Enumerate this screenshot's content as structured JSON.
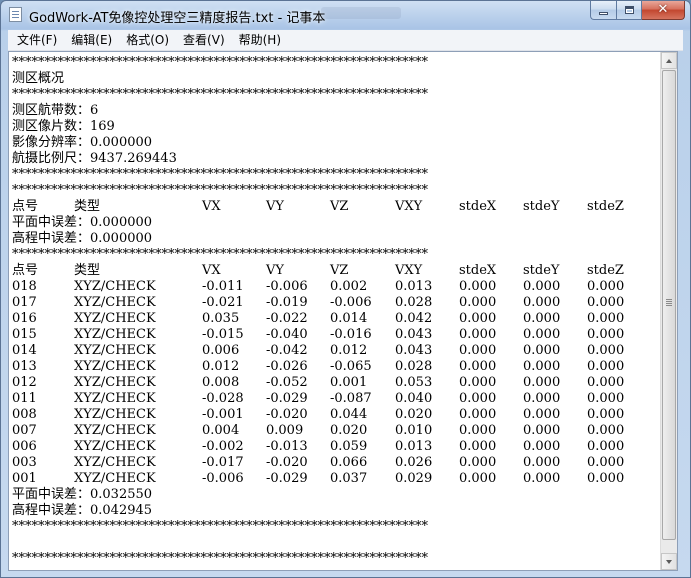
{
  "window": {
    "title": "GodWork-AT免像控处理空三精度报告.txt - 记事本"
  },
  "menu": [
    {
      "label": "文件(F)"
    },
    {
      "label": "编辑(E)"
    },
    {
      "label": "格式(O)"
    },
    {
      "label": "查看(V)"
    },
    {
      "label": "帮助(H)"
    }
  ],
  "caption": {
    "minimize_icon": "minimize-icon",
    "maximize_icon": "maximize-icon",
    "close_glyph": "✕"
  },
  "document": {
    "stars": "****************************************************************",
    "section_title": "测区概况",
    "summary": [
      "测区航带数：6",
      "测区像片数：169",
      "影像分辨率：0.000000",
      "航摄比例尺：9437.269443"
    ],
    "columns": [
      "点号",
      "类型",
      "VX",
      "VY",
      "VZ",
      "VXY",
      "stdeX",
      "stdeY",
      "stdeZ"
    ],
    "control_plane_error": "平面中误差：0.000000",
    "control_height_error": "高程中误差：0.000000",
    "check_rows": [
      [
        "018",
        "XYZ/CHECK",
        "-0.011",
        "-0.006",
        "0.002",
        "0.013",
        "0.000",
        "0.000",
        "0.000"
      ],
      [
        "017",
        "XYZ/CHECK",
        "-0.021",
        "-0.019",
        "-0.006",
        "0.028",
        "0.000",
        "0.000",
        "0.000"
      ],
      [
        "016",
        "XYZ/CHECK",
        "0.035",
        "-0.022",
        "0.014",
        "0.042",
        "0.000",
        "0.000",
        "0.000"
      ],
      [
        "015",
        "XYZ/CHECK",
        "-0.015",
        "-0.040",
        "-0.016",
        "0.043",
        "0.000",
        "0.000",
        "0.000"
      ],
      [
        "014",
        "XYZ/CHECK",
        "0.006",
        "-0.042",
        "0.012",
        "0.043",
        "0.000",
        "0.000",
        "0.000"
      ],
      [
        "013",
        "XYZ/CHECK",
        "0.012",
        "-0.026",
        "-0.065",
        "0.028",
        "0.000",
        "0.000",
        "0.000"
      ],
      [
        "012",
        "XYZ/CHECK",
        "0.008",
        "-0.052",
        "0.001",
        "0.053",
        "0.000",
        "0.000",
        "0.000"
      ],
      [
        "011",
        "XYZ/CHECK",
        "-0.028",
        "-0.029",
        "-0.087",
        "0.040",
        "0.000",
        "0.000",
        "0.000"
      ],
      [
        "008",
        "XYZ/CHECK",
        "-0.001",
        "-0.020",
        "0.044",
        "0.020",
        "0.000",
        "0.000",
        "0.000"
      ],
      [
        "007",
        "XYZ/CHECK",
        "0.004",
        "0.009",
        "0.020",
        "0.010",
        "0.000",
        "0.000",
        "0.000"
      ],
      [
        "006",
        "XYZ/CHECK",
        "-0.002",
        "-0.013",
        "0.059",
        "0.013",
        "0.000",
        "0.000",
        "0.000"
      ],
      [
        "003",
        "XYZ/CHECK",
        "-0.017",
        "-0.020",
        "0.066",
        "0.026",
        "0.000",
        "0.000",
        "0.000"
      ],
      [
        "001",
        "XYZ/CHECK",
        "-0.006",
        "-0.029",
        "0.037",
        "0.029",
        "0.000",
        "0.000",
        "0.000"
      ]
    ],
    "check_plane_error": "平面中误差：0.032550",
    "check_height_error": "高程中误差：0.042945"
  }
}
